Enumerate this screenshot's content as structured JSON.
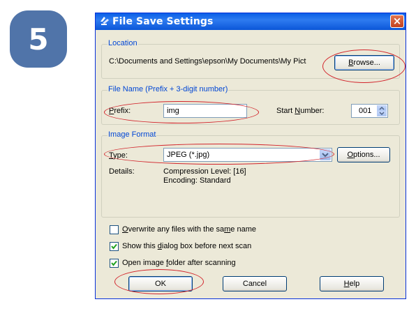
{
  "step": {
    "number": "5"
  },
  "dialog": {
    "title": "File Save Settings",
    "close_glyph": "×",
    "location": {
      "legend": "Location",
      "path": "C:\\Documents and Settings\\epson\\My Documents\\My Pict",
      "browse": {
        "pre": "",
        "key": "B",
        "post": "rowse..."
      }
    },
    "filename": {
      "legend": "File Name (Prefix + 3-digit number)",
      "prefix_label": {
        "pre": "",
        "key": "P",
        "post": "refix:"
      },
      "prefix_value": "img",
      "start_label": {
        "pre": "Start ",
        "key": "N",
        "post": "umber:"
      },
      "start_value": "001"
    },
    "format": {
      "legend": "Image Format",
      "type_label": {
        "pre": "",
        "key": "T",
        "post": "ype:"
      },
      "type_value": "JPEG (*.jpg)",
      "options": {
        "pre": "",
        "key": "O",
        "post": "ptions..."
      },
      "details_label": "Details:",
      "details_line1": "Compression Level: [16]",
      "details_line2": "Encoding: Standard"
    },
    "checkboxes": [
      {
        "pre": "",
        "key": "O",
        "post": "verwrite any files with the sa",
        "key2": "m",
        "post2": "e name",
        "checked": false
      },
      {
        "pre": "Show this ",
        "key": "d",
        "post": "ialog box before next scan",
        "key2": "",
        "post2": "",
        "checked": true
      },
      {
        "pre": "Open image ",
        "key": "f",
        "post": "older after scanning",
        "key2": "",
        "post2": "",
        "checked": true
      }
    ],
    "buttons": {
      "ok": "OK",
      "cancel": "Cancel",
      "help": {
        "pre": "",
        "key": "H",
        "post": "elp"
      }
    }
  },
  "colors": {
    "badge": "#5074a9",
    "annotation": "#d2232a",
    "check": "#21a121"
  }
}
